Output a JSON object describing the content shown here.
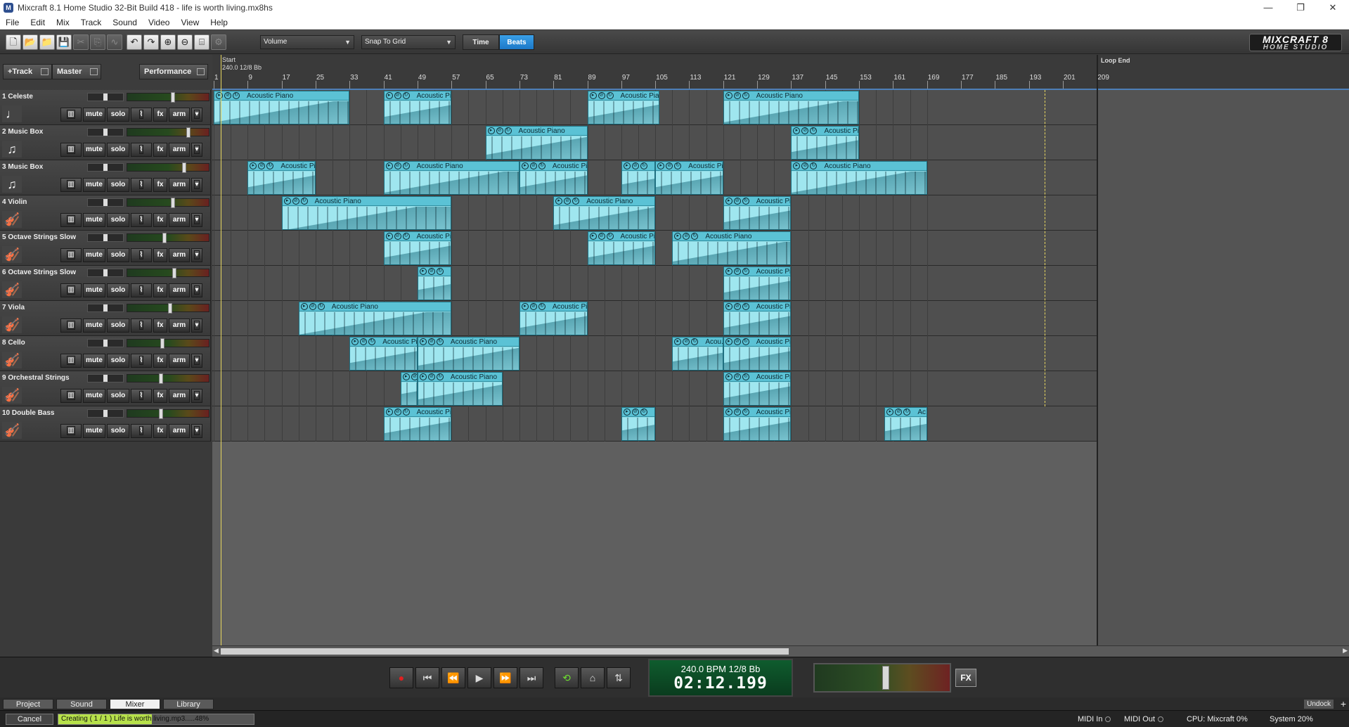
{
  "window": {
    "title": "Mixcraft 8.1 Home Studio 32-Bit Build 418 - life is worth living.mx8hs",
    "minimize": "—",
    "maximize": "❐",
    "close": "✕"
  },
  "menu": [
    "File",
    "Edit",
    "Mix",
    "Track",
    "Sound",
    "Video",
    "View",
    "Help"
  ],
  "toolbar": {
    "icons": [
      "new-file-icon",
      "open-folder-icon",
      "open-recent-icon",
      "save-icon",
      "cut-icon",
      "copy-icon",
      "waveform-icon",
      "undo-icon",
      "redo-icon",
      "zoom-in-icon",
      "zoom-out-icon",
      "midi-icon",
      "settings-icon"
    ],
    "automation_select": "Volume",
    "snap_select": "Snap To Grid",
    "time_label": "Time",
    "beats_label": "Beats",
    "logo_main": "MIXCRAFT 8",
    "logo_sub": "HOME STUDIO"
  },
  "trackbar": {
    "add_track": "+Track",
    "master": "Master",
    "performance": "Performance"
  },
  "track_controls": {
    "mute": "mute",
    "solo": "solo",
    "fx": "fx",
    "arm": "arm"
  },
  "tracks": [
    {
      "name": "1 Celeste",
      "icon": "♩",
      "icon_name": "celeste-icon",
      "fader": 0.55
    },
    {
      "name": "2 Music Box",
      "icon": "♫",
      "icon_name": "music-box-icon",
      "fader": 0.75
    },
    {
      "name": "3 Music Box",
      "icon": "♫",
      "icon_name": "music-box-icon",
      "fader": 0.7
    },
    {
      "name": "4 Violin",
      "icon": "🎻",
      "icon_name": "violin-icon",
      "fader": 0.55
    },
    {
      "name": "5 Octave Strings Slow",
      "icon": "🎻",
      "icon_name": "strings-icon",
      "fader": 0.45
    },
    {
      "name": "6 Octave Strings Slow",
      "icon": "🎻",
      "icon_name": "strings-icon",
      "fader": 0.57
    },
    {
      "name": "7 Viola",
      "icon": "🎻",
      "icon_name": "viola-icon",
      "fader": 0.52
    },
    {
      "name": "8 Cello",
      "icon": "🎻",
      "icon_name": "cello-icon",
      "fader": 0.42
    },
    {
      "name": "9 Orchestral Strings",
      "icon": "🎻",
      "icon_name": "orchestral-strings-icon",
      "fader": 0.4
    },
    {
      "name": "10 Double Bass",
      "icon": "🎻",
      "icon_name": "double-bass-icon",
      "fader": 0.4
    }
  ],
  "ruler": {
    "start_marker": "Start",
    "tempo_marker": "240.0 12/8 Bb",
    "loop_end_marker": "Loop End",
    "bars": [
      "1",
      "9",
      "17",
      "25",
      "33",
      "41",
      "49",
      "57",
      "65",
      "73",
      "81",
      "89",
      "97",
      "105",
      "113",
      "121",
      "129",
      "137",
      "145",
      "153",
      "161",
      "169",
      "177",
      "185",
      "193",
      "201",
      "209"
    ]
  },
  "clips": [
    {
      "track": 0,
      "start": 1,
      "end": 33,
      "label": "Acoustic Piano"
    },
    {
      "track": 0,
      "start": 41,
      "end": 57,
      "label": "Acoustic Pi..."
    },
    {
      "track": 0,
      "start": 89,
      "end": 106,
      "label": "Acoustic Pia..."
    },
    {
      "track": 0,
      "start": 121,
      "end": 153,
      "label": "Acoustic Piano"
    },
    {
      "track": 1,
      "start": 65,
      "end": 89,
      "label": "Acoustic Piano"
    },
    {
      "track": 1,
      "start": 137,
      "end": 153,
      "label": "Acoustic Pi..."
    },
    {
      "track": 2,
      "start": 9,
      "end": 25,
      "label": "Acoustic Pi..."
    },
    {
      "track": 2,
      "start": 41,
      "end": 73,
      "label": "Acoustic Piano"
    },
    {
      "track": 2,
      "start": 73,
      "end": 89,
      "label": "Acoustic Pi..."
    },
    {
      "track": 2,
      "start": 97,
      "end": 105,
      "label": "Ac..."
    },
    {
      "track": 2,
      "start": 105,
      "end": 121,
      "label": "Acoustic Pi..."
    },
    {
      "track": 2,
      "start": 137,
      "end": 169,
      "label": "Acoustic Piano"
    },
    {
      "track": 3,
      "start": 17,
      "end": 57,
      "label": "Acoustic Piano"
    },
    {
      "track": 3,
      "start": 81,
      "end": 105,
      "label": "Acoustic Piano"
    },
    {
      "track": 3,
      "start": 121,
      "end": 137,
      "label": "Acoustic Pi..."
    },
    {
      "track": 4,
      "start": 41,
      "end": 57,
      "label": "Acoustic Pi..."
    },
    {
      "track": 4,
      "start": 89,
      "end": 105,
      "label": "Acoustic Pi..."
    },
    {
      "track": 4,
      "start": 109,
      "end": 137,
      "label": "Acoustic Piano"
    },
    {
      "track": 5,
      "start": 49,
      "end": 57,
      "label": "Ac..."
    },
    {
      "track": 5,
      "start": 121,
      "end": 137,
      "label": "Acoustic Pi..."
    },
    {
      "track": 6,
      "start": 21,
      "end": 57,
      "label": "Acoustic Piano"
    },
    {
      "track": 6,
      "start": 73,
      "end": 89,
      "label": "Acoustic Pi..."
    },
    {
      "track": 6,
      "start": 121,
      "end": 137,
      "label": "Acoustic Pi..."
    },
    {
      "track": 7,
      "start": 33,
      "end": 49,
      "label": "Acoustic Pi..."
    },
    {
      "track": 7,
      "start": 49,
      "end": 73,
      "label": "Acoustic Piano"
    },
    {
      "track": 7,
      "start": 109,
      "end": 121,
      "label": "Acou..."
    },
    {
      "track": 7,
      "start": 121,
      "end": 137,
      "label": "Acoustic Pi..."
    },
    {
      "track": 8,
      "start": 45,
      "end": 49,
      "label": "Ac..."
    },
    {
      "track": 8,
      "start": 49,
      "end": 69,
      "label": "Acoustic Piano"
    },
    {
      "track": 8,
      "start": 121,
      "end": 137,
      "label": "Acoustic Pi..."
    },
    {
      "track": 9,
      "start": 41,
      "end": 57,
      "label": "Acoustic Pi..."
    },
    {
      "track": 9,
      "start": 97,
      "end": 105,
      "label": "Ac..."
    },
    {
      "track": 9,
      "start": 121,
      "end": 137,
      "label": "Acoustic Pi..."
    },
    {
      "track": 9,
      "start": 159,
      "end": 169,
      "label": "Ac..."
    }
  ],
  "transport": {
    "bpm_line": "240.0 BPM  12/8    Bb",
    "time": "02:12.199",
    "fx_label": "FX",
    "master_level": 0.53
  },
  "tabs": {
    "project": "Project",
    "sound": "Sound",
    "mixer": "Mixer",
    "library": "Library",
    "undock": "Undock",
    "add": "+"
  },
  "status": {
    "cancel": "Cancel",
    "progress_text": "Creating ( 1 / 1 ) Life is worth living.mp3.....48%",
    "progress": 0.48,
    "midi_in": "MIDI In",
    "midi_out": "MIDI Out",
    "cpu": "CPU: Mixcraft 0%",
    "system": "System 20%"
  }
}
